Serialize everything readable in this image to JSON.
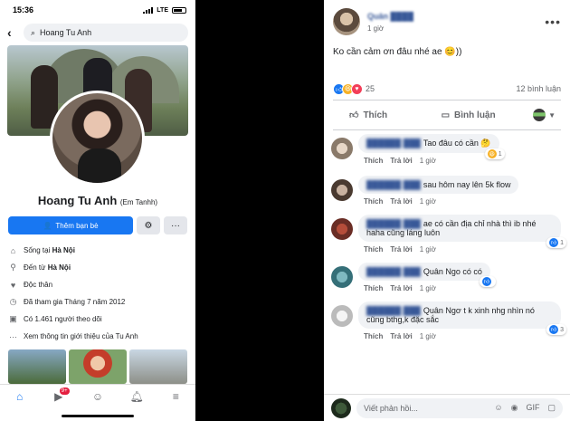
{
  "left_phone": {
    "status": {
      "time": "15:36",
      "network": "LTE"
    },
    "search": {
      "query": "Hoang Tu Anh"
    },
    "profile": {
      "name": "Hoang Tu Anh",
      "alt_name": "(Em Tanhh)",
      "add_friend_label": "Thêm bạn bè",
      "more_label": "···"
    },
    "info": [
      {
        "icon": "house-icon",
        "glyph": "⌂",
        "text": "Sống tại ",
        "bold": "Hà Nội"
      },
      {
        "icon": "location-pin-icon",
        "glyph": "⚲",
        "text": "Đến từ ",
        "bold": "Hà Nội"
      },
      {
        "icon": "heart-icon",
        "glyph": "♥",
        "text": "Độc thân",
        "bold": ""
      },
      {
        "icon": "clock-icon",
        "glyph": "◷",
        "text": "Đã tham gia Tháng 7 năm 2012",
        "bold": ""
      },
      {
        "icon": "followers-icon",
        "glyph": "▣",
        "text": "Có 1.461 người theo dõi",
        "bold": ""
      },
      {
        "icon": "more-dots-icon",
        "glyph": "···",
        "text": "Xem thông tin giới thiệu của Tu Anh",
        "bold": ""
      }
    ],
    "tabbar": {
      "video_badge": "9+"
    }
  },
  "right_post": {
    "time": "1 giờ",
    "text": "Ko cần cảm ơn đâu nhé ae 😊))",
    "reaction_count": "25",
    "comment_count": "12 bình luận",
    "like_label": "Thích",
    "comment_label": "Bình luận",
    "comments": [
      {
        "text": "Tao đâu có cần 🤔",
        "like": "Thích",
        "reply": "Trả lời",
        "time": "1 giờ",
        "react": "1",
        "react_type": "haha"
      },
      {
        "text": "sau hôm nay lên 5k flow",
        "like": "Thích",
        "reply": "Trả lời",
        "time": "1 giờ",
        "react": "",
        "react_type": ""
      },
      {
        "text": "ae có cần địa chỉ nhà thì ib nhé haha cũng láng luôn",
        "like": "Thích",
        "reply": "Trả lời",
        "time": "1 giờ",
        "react": "1",
        "react_type": "like"
      },
      {
        "text": "Quân Ngo có có ",
        "like": "Thích",
        "reply": "Trả lời",
        "time": "1 giờ",
        "react": "",
        "react_type": "like"
      },
      {
        "text": "Quân Ngơ t k xinh nhg nhìn nó cũng bthg,k đặc sắc",
        "like": "Thích",
        "reply": "Trả lời",
        "time": "1 giờ",
        "react": "3",
        "react_type": "like"
      }
    ],
    "composer_placeholder": "Viết phản hồi..."
  },
  "colors": {
    "facebook_blue": "#1877f2",
    "text": "#1c1e21",
    "muted": "#65676b"
  }
}
